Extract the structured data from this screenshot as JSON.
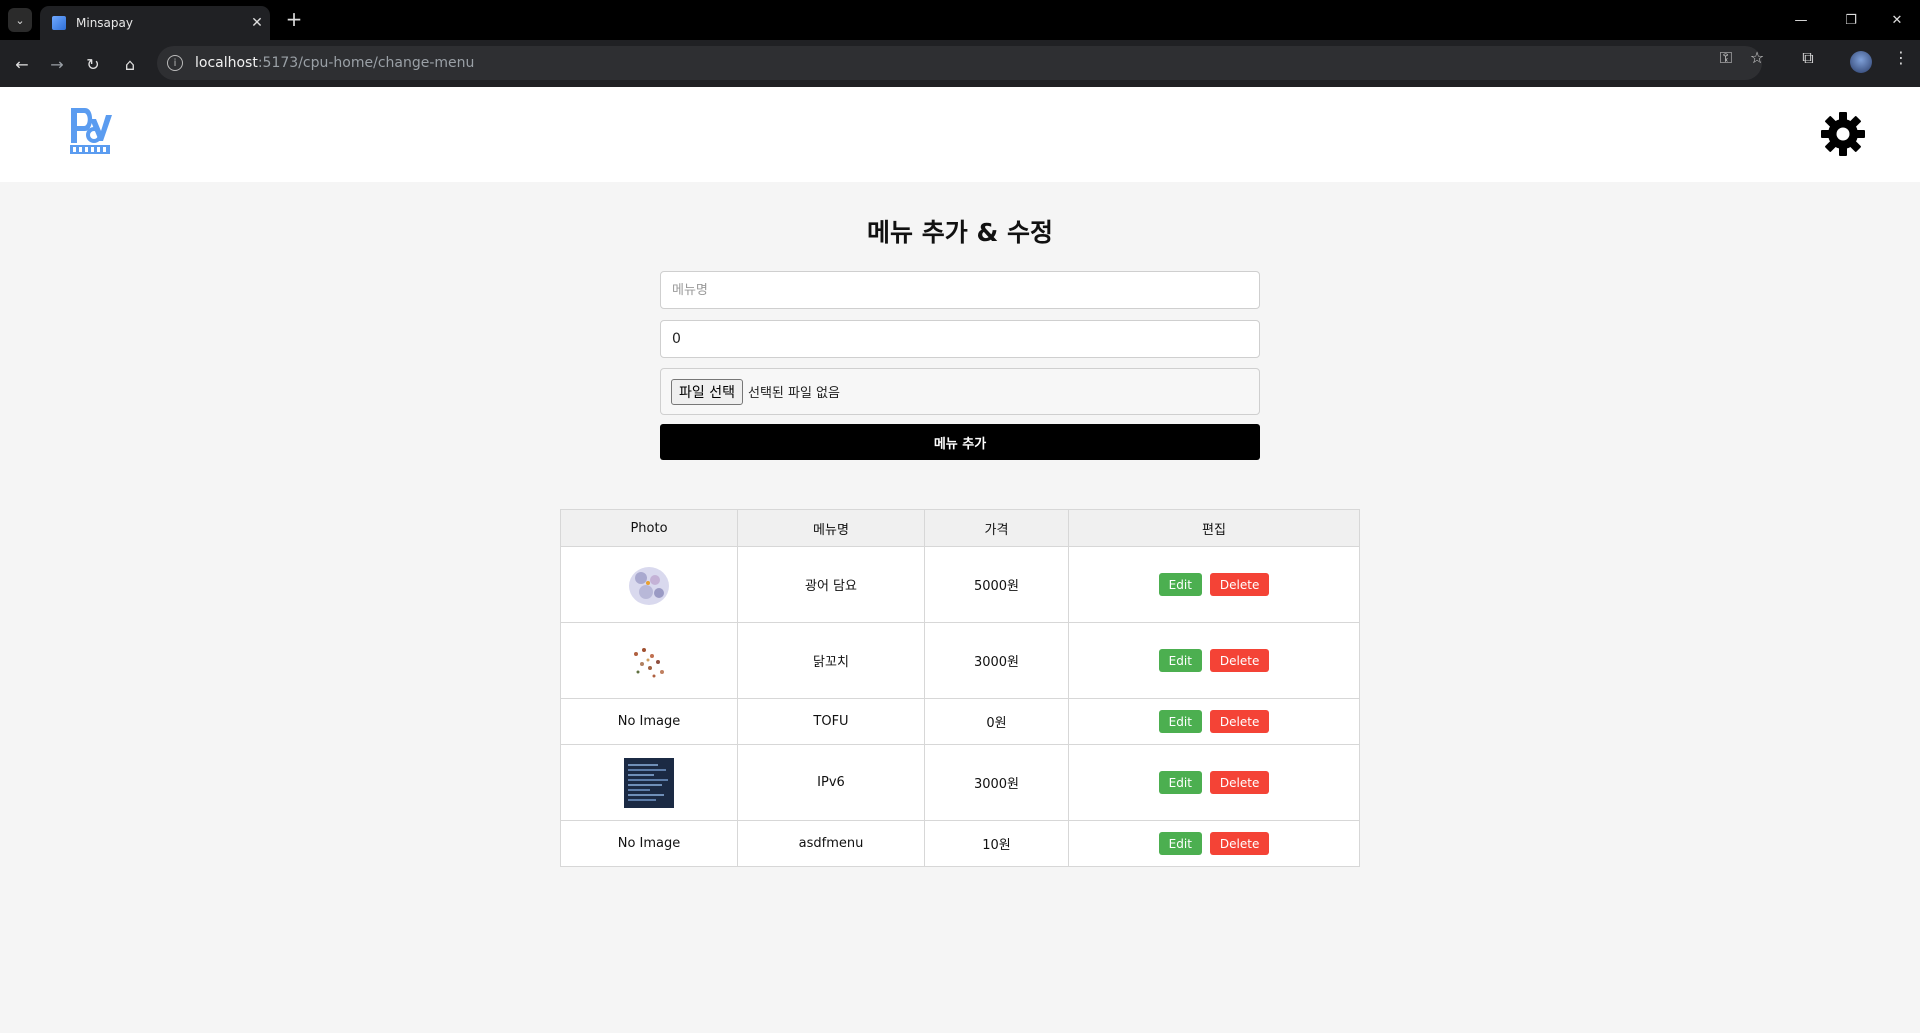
{
  "browser": {
    "tab_title": "Minsapay",
    "url_host": "localhost",
    "url_path": ":5173/cpu-home/change-menu"
  },
  "page": {
    "heading": "메뉴 추가 & 수정",
    "form": {
      "name_placeholder": "메뉴명",
      "price_value": "0",
      "file_button": "파일 선택",
      "file_status": "선택된 파일 없음",
      "submit_label": "메뉴 추가"
    },
    "table": {
      "headers": [
        "Photo",
        "메뉴명",
        "가격",
        "편집"
      ],
      "rows": [
        {
          "photo": "image",
          "photo_label": "",
          "name": "광어 담요",
          "price": "5000원"
        },
        {
          "photo": "image",
          "photo_label": "",
          "name": "닭꼬치",
          "price": "3000원"
        },
        {
          "photo": "none",
          "photo_label": "No Image",
          "name": "TOFU",
          "price": "0원"
        },
        {
          "photo": "image",
          "photo_label": "",
          "name": "IPv6",
          "price": "3000원"
        },
        {
          "photo": "none",
          "photo_label": "No Image",
          "name": "asdfmenu",
          "price": "10원"
        }
      ],
      "edit_label": "Edit",
      "delete_label": "Delete"
    }
  },
  "colors": {
    "edit": "#4caf50",
    "delete": "#f44336",
    "submit": "#000000"
  },
  "icons": [
    "settings-gear-icon",
    "logo-icon"
  ]
}
